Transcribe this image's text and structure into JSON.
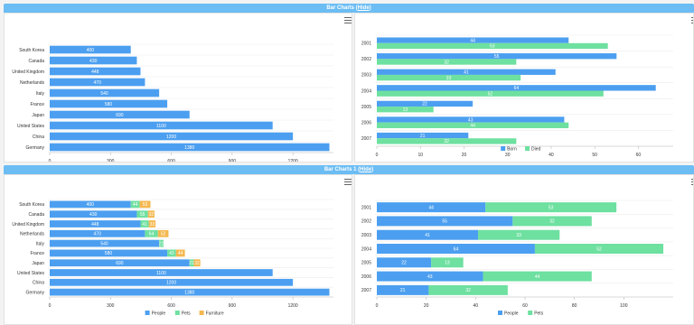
{
  "sections": [
    {
      "title": "Bar Charts",
      "hide_label": "Hide"
    },
    {
      "title": "Bar Charts 1",
      "hide_label": "Hide"
    }
  ],
  "colors": {
    "people": "#4c9ff0",
    "pets": "#6ee0a0",
    "furniture": "#f4b84f",
    "titlebar": "#6cbdf4"
  },
  "icons": {
    "menu": "hamburger-menu-icon",
    "cursor": "mouse-pointer-icon"
  },
  "chart_data": [
    {
      "type": "bar",
      "orientation": "horizontal",
      "categories": [
        "South Korea",
        "Canada",
        "United Kingdom",
        "Netherlands",
        "Italy",
        "France",
        "Japan",
        "United States",
        "China",
        "Germany"
      ],
      "series": [
        {
          "values": [
            400,
            430,
            448,
            470,
            540,
            580,
            690,
            1100,
            1200,
            1380
          ]
        }
      ],
      "xlim": [
        0,
        1400
      ],
      "xticks": [
        0,
        300,
        600,
        900,
        1200
      ],
      "grid": true
    },
    {
      "type": "bar",
      "orientation": "horizontal",
      "categories": [
        "2001",
        "2002",
        "2003",
        "2004",
        "2005",
        "2006",
        "2007"
      ],
      "series": [
        {
          "name": "Born",
          "values": [
            44,
            55,
            41,
            64,
            22,
            43,
            21
          ]
        },
        {
          "name": "Died",
          "values": [
            53,
            32,
            33,
            52,
            13,
            44,
            32
          ]
        }
      ],
      "xlim": [
        0,
        68
      ],
      "xticks": [
        0,
        10,
        20,
        30,
        40,
        50,
        60
      ],
      "legend": "bottom",
      "grid": true
    },
    {
      "type": "bar",
      "orientation": "horizontal",
      "stacked": true,
      "categories": [
        "South Korea",
        "Canada",
        "United Kingdom",
        "Netherlands",
        "Italy",
        "France",
        "Japan",
        "United States",
        "China",
        "Germany"
      ],
      "series": [
        {
          "name": "People",
          "values": [
            400,
            430,
            448,
            470,
            540,
            580,
            690,
            1100,
            1200,
            1380
          ]
        },
        {
          "name": "Pets",
          "values": [
            44,
            55,
            41,
            64,
            22,
            43,
            21,
            0,
            0,
            0
          ]
        },
        {
          "name": "Furniture",
          "values": [
            53,
            32,
            33,
            52,
            0,
            44,
            32,
            0,
            0,
            0
          ]
        }
      ],
      "xlim": [
        0,
        1400
      ],
      "xticks": [
        0,
        300,
        600,
        900,
        1200
      ],
      "legend": "bottom",
      "grid": true
    },
    {
      "type": "bar",
      "orientation": "horizontal",
      "stacked": true,
      "categories": [
        "2001",
        "2002",
        "2003",
        "2004",
        "2005",
        "2006",
        "2007"
      ],
      "series": [
        {
          "name": "People",
          "values": [
            44,
            55,
            41,
            64,
            22,
            43,
            21
          ]
        },
        {
          "name": "Pets",
          "values": [
            53,
            32,
            33,
            52,
            13,
            44,
            32
          ]
        }
      ],
      "xlim": [
        0,
        120
      ],
      "xticks": [
        0,
        20,
        40,
        60,
        80,
        100
      ],
      "legend": "bottom",
      "grid": true
    }
  ]
}
